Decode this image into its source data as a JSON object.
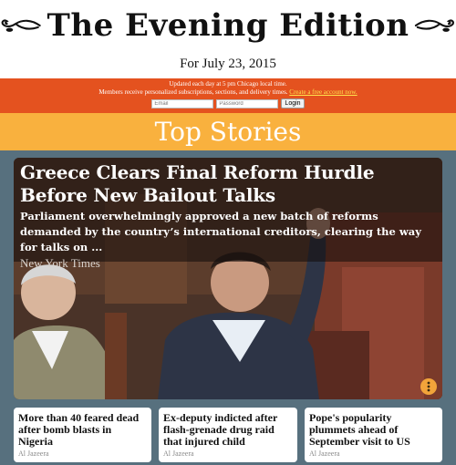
{
  "masthead": {
    "brand": "The Evening Edition",
    "date": "For July 23, 2015"
  },
  "notice": {
    "update_line": "Updated each day at 5 pm Chicago local time.",
    "members_line": "Members receive personalized subscriptions, sections, and delivery times.",
    "create_account_link": "Create a free account now.",
    "email_placeholder": "Email",
    "password_placeholder": "Password",
    "login_label": "Login"
  },
  "section": {
    "title": "Top Stories"
  },
  "feature": {
    "headline": "Greece Clears Final Reform Hurdle Before New Bailout Talks",
    "summary": "Parliament overwhelmingly approved a new batch of reforms demanded by the country’s international creditors, clearing the way for talks on ...",
    "source": "New York Times",
    "more_icon": "more-vertical-icon"
  },
  "cards": [
    {
      "headline": "More than 40 feared dead after bomb blasts in Nigeria",
      "source": "Al Jazeera"
    },
    {
      "headline": "Ex-deputy indicted after flash-grenade drug raid that injured child",
      "source": "Al Jazeera"
    },
    {
      "headline": "Pope's popularity plummets ahead of September visit to US",
      "source": "Al Jazeera"
    }
  ],
  "colors": {
    "notice_bar": "#e4521f",
    "section_banner": "#f9b13e",
    "board": "#57707e",
    "more_button": "#f2a43a"
  }
}
